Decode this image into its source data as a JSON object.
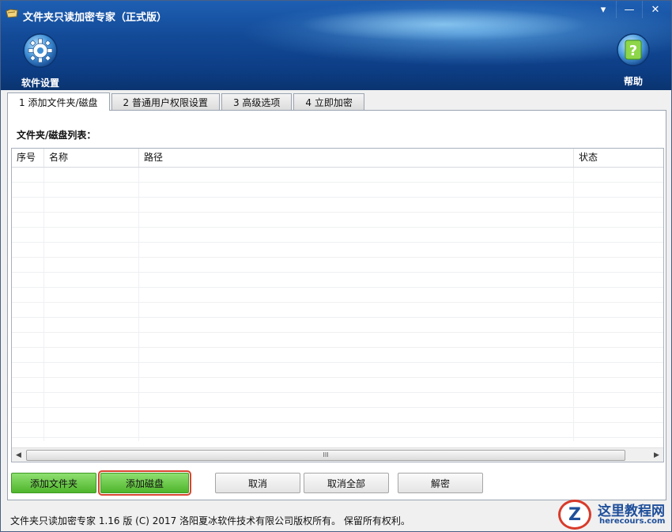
{
  "window": {
    "title": "文件夹只读加密专家（正式版）",
    "controls": {
      "menu": "▾",
      "minimize": "—",
      "close": "✕"
    }
  },
  "toolbar": {
    "settings_label": "软件设置",
    "help_label": "帮助",
    "settings_icon": "gear-icon",
    "help_icon": "question-icon"
  },
  "tabs": [
    {
      "label": "1 添加文件夹/磁盘",
      "active": true
    },
    {
      "label": "2 普通用户权限设置",
      "active": false
    },
    {
      "label": "3 高级选项",
      "active": false
    },
    {
      "label": "4 立即加密",
      "active": false
    }
  ],
  "list": {
    "caption": "文件夹/磁盘列表：",
    "columns": [
      "序号",
      "名称",
      "路径",
      "状态"
    ],
    "rows": [],
    "scroll_grip": "III"
  },
  "buttons": {
    "add_folder": "添加文件夹",
    "add_disk": "添加磁盘",
    "cancel": "取消",
    "cancel_all": "取消全部",
    "decrypt": "解密"
  },
  "status_bar": {
    "text": "文件夹只读加密专家 1.16 版  (C)  2017 洛阳夏冰软件技术有限公司版权所有。 保留所有权利。"
  },
  "watermark": {
    "logo_letter": "Z",
    "title": "这里教程网",
    "url": "herecours.com"
  },
  "colors": {
    "banner_dark": "#0d3e86",
    "banner_light": "#1e5fb3",
    "green_button": "#4fb52c",
    "highlight_outline": "#d9452f"
  }
}
